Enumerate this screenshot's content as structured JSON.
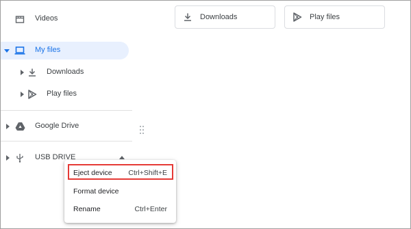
{
  "sidebar": {
    "items": [
      {
        "label": "Videos",
        "icon": "videos-icon"
      },
      {
        "label": "My files",
        "icon": "laptop-icon",
        "selected": true
      },
      {
        "label": "Downloads",
        "icon": "download-icon"
      },
      {
        "label": "Play files",
        "icon": "play-store-icon"
      },
      {
        "label": "Google Drive",
        "icon": "google-drive-icon"
      },
      {
        "label": "USB DRIVE",
        "icon": "usb-icon"
      }
    ]
  },
  "main": {
    "tiles": [
      {
        "label": "Downloads",
        "icon": "download-icon"
      },
      {
        "label": "Play files",
        "icon": "play-store-icon"
      }
    ]
  },
  "context_menu": {
    "items": [
      {
        "label": "Eject device",
        "shortcut": "Ctrl+Shift+E",
        "highlighted": true
      },
      {
        "label": "Format device",
        "shortcut": ""
      },
      {
        "label": "Rename",
        "shortcut": "Ctrl+Enter"
      }
    ]
  },
  "colors": {
    "accent": "#1a73e8",
    "selected_bg": "#e8f0fe",
    "highlight_border": "#e53935",
    "text": "#3c4043"
  }
}
